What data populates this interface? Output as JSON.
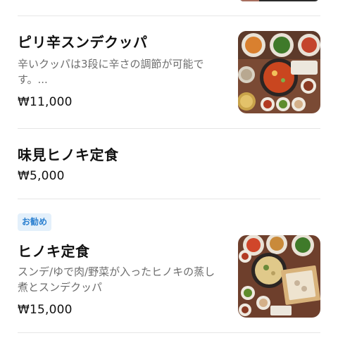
{
  "menu": {
    "items": [
      {
        "title": "ピリ辛スンデクッパ",
        "description": "辛いクッパは3段に辛さの調節が可能です。...",
        "price": "₩11,000",
        "image_icon": "spicy-sundae-gukbap-photo"
      },
      {
        "title": "味見ヒノキ定食",
        "price": "₩5,000"
      },
      {
        "badge": "お勧め",
        "title": "ヒノキ定食",
        "description": "スンデ/ゆで肉/野菜が入ったヒノキの蒸し煮とスンデクッパ",
        "price": "₩15,000",
        "image_icon": "hinoki-set-meal-photo"
      }
    ]
  }
}
